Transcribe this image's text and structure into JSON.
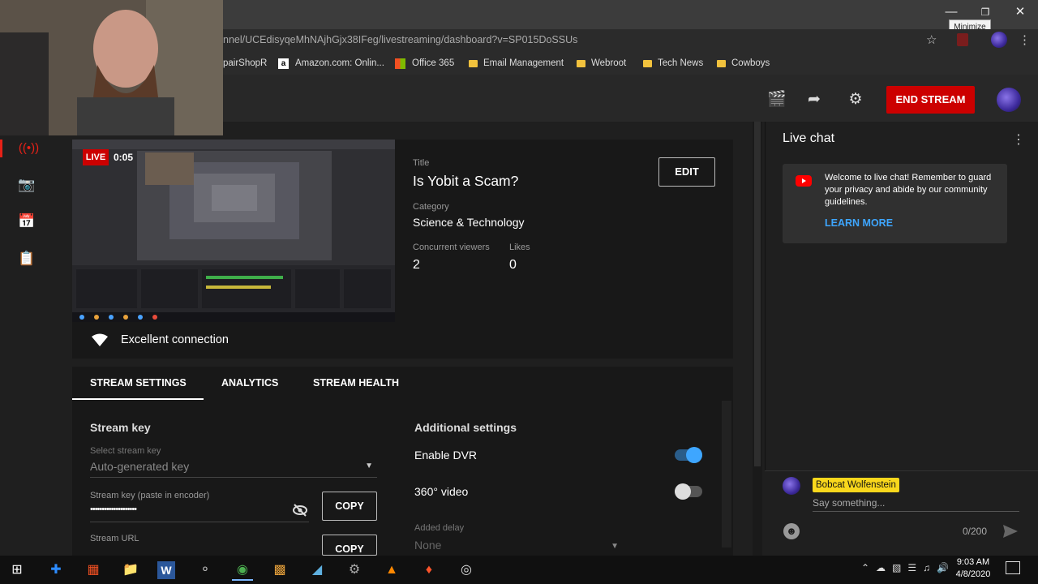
{
  "browser": {
    "url": "nnel/UCEdisyqeMhNAjhGjx38IFeg/livestreaming/dashboard?v=SP015DoSSUs",
    "tooltip": "Minimize",
    "bookmarks": [
      {
        "label": "pairShopR"
      },
      {
        "label": "Amazon.com: Onlin..."
      },
      {
        "label": "Office 365"
      },
      {
        "label": "Email Management"
      },
      {
        "label": "Webroot"
      },
      {
        "label": "Tech News"
      },
      {
        "label": "Cowboys"
      }
    ]
  },
  "header": {
    "end_stream": "END STREAM"
  },
  "video": {
    "live_badge": "LIVE",
    "elapsed": "0:05",
    "title_label": "Title",
    "title": "Is Yobit a Scam?",
    "category_label": "Category",
    "category": "Science & Technology",
    "viewers_label": "Concurrent viewers",
    "viewers": "2",
    "likes_label": "Likes",
    "likes": "0",
    "edit": "EDIT",
    "connection": "Excellent connection"
  },
  "tabs": [
    {
      "label": "STREAM SETTINGS",
      "active": true
    },
    {
      "label": "ANALYTICS"
    },
    {
      "label": "STREAM HEALTH"
    }
  ],
  "stream_settings": {
    "stream_key_heading": "Stream key",
    "select_key_label": "Select stream key",
    "select_key_value": "Auto-generated key",
    "key_label": "Stream key (paste in encoder)",
    "key_value": "••••••••••••••••••••",
    "copy": "COPY",
    "url_label": "Stream URL",
    "copy2": "COPY"
  },
  "additional": {
    "heading": "Additional settings",
    "dvr": "Enable DVR",
    "dvr_on": true,
    "video360": "360° video",
    "video360_on": false,
    "delay_label": "Added delay",
    "delay_value": "None"
  },
  "chat": {
    "title": "Live chat",
    "welcome": "Welcome to live chat! Remember to guard your privacy and abide by our community guidelines.",
    "learn_more": "LEARN MORE",
    "username": "Bobcat Wolfenstein",
    "placeholder": "Say something...",
    "counter": "0/200"
  },
  "taskbar": {
    "time": "9:03 AM",
    "date": "4/8/2020"
  },
  "colors": {
    "accent_red": "#cc0000",
    "link_blue": "#3ea6ff",
    "toggle_blue": "#3ea6ff",
    "username_yellow": "#f9d71c"
  }
}
